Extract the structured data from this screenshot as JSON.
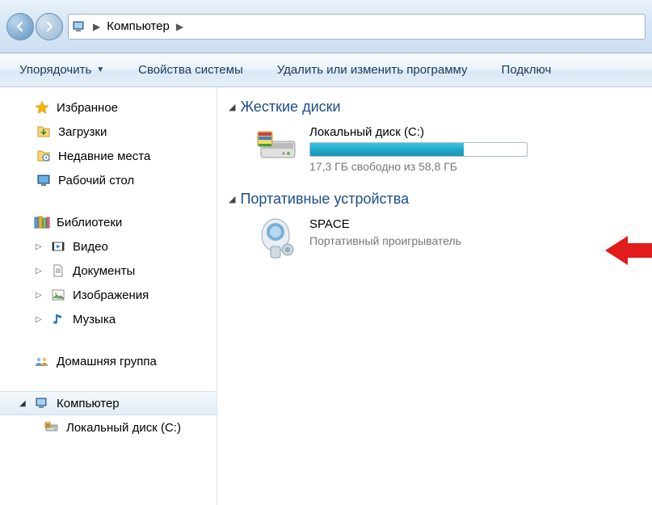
{
  "nav": {
    "breadcrumb": [
      "Компьютер"
    ]
  },
  "toolbar": {
    "organize": "Упорядочить",
    "system_props": "Свойства системы",
    "uninstall": "Удалить или изменить программу",
    "connect": "Подключ"
  },
  "sidebar": {
    "favorites": {
      "label": "Избранное",
      "items": [
        {
          "label": "Загрузки",
          "icon": "downloads-icon"
        },
        {
          "label": "Недавние места",
          "icon": "recent-icon"
        },
        {
          "label": "Рабочий стол",
          "icon": "desktop-icon"
        }
      ]
    },
    "libraries": {
      "label": "Библиотеки",
      "items": [
        {
          "label": "Видео",
          "icon": "video-icon"
        },
        {
          "label": "Документы",
          "icon": "documents-icon"
        },
        {
          "label": "Изображения",
          "icon": "pictures-icon"
        },
        {
          "label": "Музыка",
          "icon": "music-icon"
        }
      ]
    },
    "homegroup": {
      "label": "Домашняя группа"
    },
    "computer": {
      "label": "Компьютер",
      "items": [
        {
          "label": "Локальный диск (C:)",
          "icon": "drive-icon"
        }
      ]
    }
  },
  "content": {
    "sections": [
      {
        "title": "Жесткие диски",
        "drives": [
          {
            "name": "Локальный диск (C:)",
            "free_text": "17,3 ГБ свободно из 58,8 ГБ",
            "fill_percent": 71
          }
        ]
      },
      {
        "title": "Портативные устройства",
        "devices": [
          {
            "name": "SPACE",
            "subtitle": "Портативный проигрыватель"
          }
        ]
      }
    ]
  }
}
